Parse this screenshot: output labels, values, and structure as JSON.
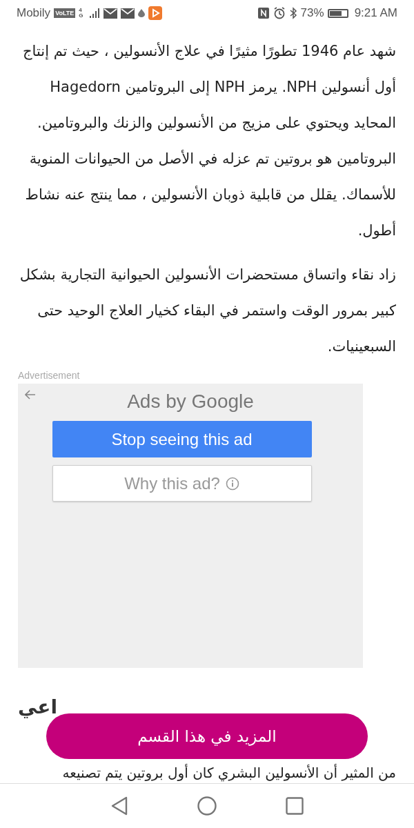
{
  "status_bar": {
    "carrier": "Mobily",
    "volte": "VoLTE",
    "network": "4G",
    "battery_text": "73%",
    "battery": {
      "level": 0.73
    },
    "time": "9:21 AM"
  },
  "article": {
    "paragraphs": [
      "شهد عام 1946 تطورًا مثيرًا في علاج الأنسولين ، حيث تم إنتاج أول أنسولين NPH. يرمز NPH إلى البروتامين Hagedorn المحايد ويحتوي على مزيج من الأنسولين والزنك والبروتامين. البروتامين هو بروتين تم عزله في الأصل من الحيوانات المنوية للأسماك. يقلل من قابلية ذوبان الأنسولين ، مما ينتج عنه نشاط أطول.",
      "زاد نقاء واتساق مستحضرات الأنسولين الحيوانية التجارية بشكل كبير بمرور الوقت واستمر في البقاء كخيار العلاج الوحيد حتى السبعينيات."
    ]
  },
  "ad": {
    "label": "Advertisement",
    "heading": "Ads by Google",
    "stop_button": "Stop seeing this ad",
    "why_button": "Why this ad?"
  },
  "section_heading": "اعي",
  "more_button": "المزيد في هذا القسم",
  "last_line": "من المثير أن الأنسولين البشري كان أول بروتين يتم تصنيعه"
}
